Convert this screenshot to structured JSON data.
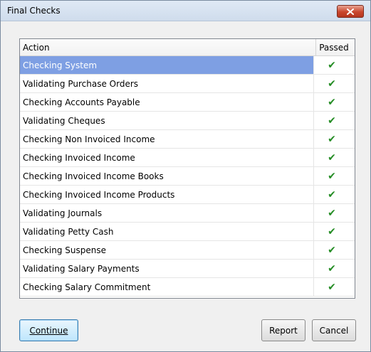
{
  "window": {
    "title": "Final Checks"
  },
  "grid": {
    "columns": {
      "action": "Action",
      "passed": "Passed"
    },
    "rows": [
      {
        "action": "Checking System",
        "passed": "✔",
        "selected": true
      },
      {
        "action": "Validating Purchase Orders",
        "passed": "✔"
      },
      {
        "action": "Checking Accounts Payable",
        "passed": "✔"
      },
      {
        "action": "Validating Cheques",
        "passed": "✔"
      },
      {
        "action": "Checking Non Invoiced Income",
        "passed": "✔"
      },
      {
        "action": "Checking Invoiced Income",
        "passed": "✔"
      },
      {
        "action": "Checking Invoiced Income Books",
        "passed": "✔"
      },
      {
        "action": "Checking Invoiced Income Products",
        "passed": "✔"
      },
      {
        "action": "Validating Journals",
        "passed": "✔"
      },
      {
        "action": "Validating Petty Cash",
        "passed": "✔"
      },
      {
        "action": "Checking Suspense",
        "passed": "✔"
      },
      {
        "action": "Validating Salary Payments",
        "passed": "✔"
      },
      {
        "action": "Checking Salary Commitment",
        "passed": "✔"
      }
    ]
  },
  "buttons": {
    "continue": "Continue",
    "report": "Report",
    "cancel": "Cancel"
  },
  "colors": {
    "selected_row": "#7e9fe3",
    "check": "#238c23",
    "close_button": "#c9452c"
  }
}
